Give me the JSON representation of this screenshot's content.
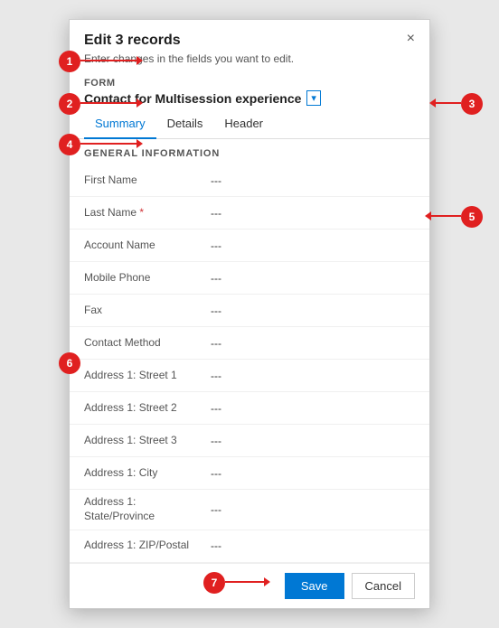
{
  "dialog": {
    "title": "Edit 3 records",
    "subtitle": "Enter changes in the fields you want to edit.",
    "close_label": "×"
  },
  "form": {
    "label": "Form",
    "name": "Contact for Multisession experience",
    "select_icon": "▾"
  },
  "tabs": [
    {
      "label": "Summary",
      "active": true
    },
    {
      "label": "Details",
      "active": false
    },
    {
      "label": "Header",
      "active": false
    }
  ],
  "section": {
    "title": "GENERAL INFORMATION"
  },
  "fields": [
    {
      "label": "First Name",
      "required": false,
      "value": "---"
    },
    {
      "label": "Last Name",
      "required": true,
      "value": "---"
    },
    {
      "label": "Account Name",
      "required": false,
      "value": "---"
    },
    {
      "label": "Mobile Phone",
      "required": false,
      "value": "---"
    },
    {
      "label": "Fax",
      "required": false,
      "value": "---"
    },
    {
      "label": "Contact Method",
      "required": false,
      "value": "---"
    },
    {
      "label": "Address 1: Street 1",
      "required": false,
      "value": "---"
    },
    {
      "label": "Address 1: Street 2",
      "required": false,
      "value": "---"
    },
    {
      "label": "Address 1: Street 3",
      "required": false,
      "value": "---"
    },
    {
      "label": "Address 1: City",
      "required": false,
      "value": "---"
    },
    {
      "label": "Address 1: State/Province",
      "required": false,
      "value": "---"
    },
    {
      "label": "Address 1: ZIP/Postal",
      "required": false,
      "value": "---"
    }
  ],
  "footer": {
    "save_label": "Save",
    "cancel_label": "Cancel"
  },
  "annotations": [
    {
      "id": "1",
      "text": "1"
    },
    {
      "id": "2",
      "text": "2"
    },
    {
      "id": "3",
      "text": "3"
    },
    {
      "id": "4",
      "text": "4"
    },
    {
      "id": "5",
      "text": "5"
    },
    {
      "id": "6",
      "text": "6"
    },
    {
      "id": "7",
      "text": "7"
    }
  ]
}
